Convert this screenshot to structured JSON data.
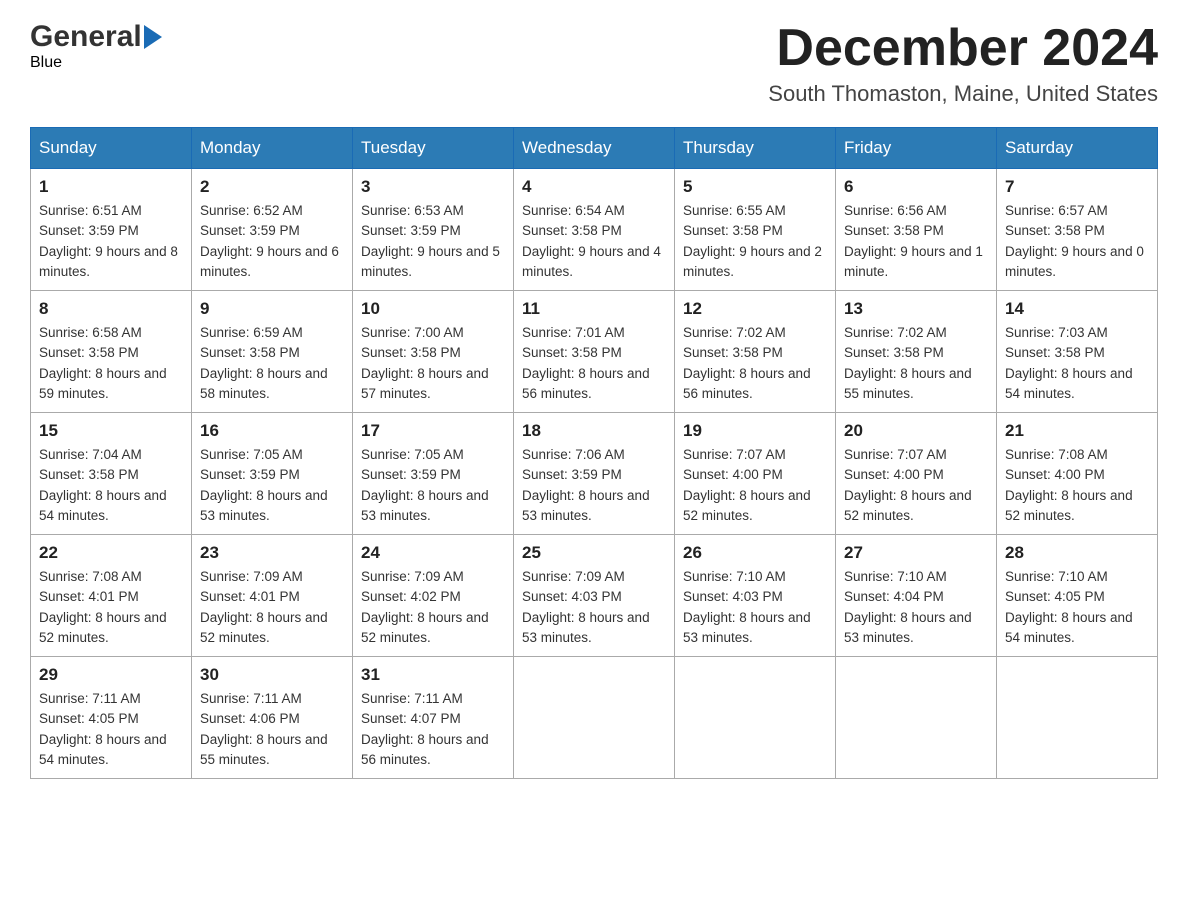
{
  "header": {
    "logo_general": "General",
    "logo_blue": "Blue",
    "month_title": "December 2024",
    "location": "South Thomaston, Maine, United States"
  },
  "days_of_week": [
    "Sunday",
    "Monday",
    "Tuesday",
    "Wednesday",
    "Thursday",
    "Friday",
    "Saturday"
  ],
  "weeks": [
    [
      {
        "day": "1",
        "sunrise": "6:51 AM",
        "sunset": "3:59 PM",
        "daylight": "9 hours and 8 minutes."
      },
      {
        "day": "2",
        "sunrise": "6:52 AM",
        "sunset": "3:59 PM",
        "daylight": "9 hours and 6 minutes."
      },
      {
        "day": "3",
        "sunrise": "6:53 AM",
        "sunset": "3:59 PM",
        "daylight": "9 hours and 5 minutes."
      },
      {
        "day": "4",
        "sunrise": "6:54 AM",
        "sunset": "3:58 PM",
        "daylight": "9 hours and 4 minutes."
      },
      {
        "day": "5",
        "sunrise": "6:55 AM",
        "sunset": "3:58 PM",
        "daylight": "9 hours and 2 minutes."
      },
      {
        "day": "6",
        "sunrise": "6:56 AM",
        "sunset": "3:58 PM",
        "daylight": "9 hours and 1 minute."
      },
      {
        "day": "7",
        "sunrise": "6:57 AM",
        "sunset": "3:58 PM",
        "daylight": "9 hours and 0 minutes."
      }
    ],
    [
      {
        "day": "8",
        "sunrise": "6:58 AM",
        "sunset": "3:58 PM",
        "daylight": "8 hours and 59 minutes."
      },
      {
        "day": "9",
        "sunrise": "6:59 AM",
        "sunset": "3:58 PM",
        "daylight": "8 hours and 58 minutes."
      },
      {
        "day": "10",
        "sunrise": "7:00 AM",
        "sunset": "3:58 PM",
        "daylight": "8 hours and 57 minutes."
      },
      {
        "day": "11",
        "sunrise": "7:01 AM",
        "sunset": "3:58 PM",
        "daylight": "8 hours and 56 minutes."
      },
      {
        "day": "12",
        "sunrise": "7:02 AM",
        "sunset": "3:58 PM",
        "daylight": "8 hours and 56 minutes."
      },
      {
        "day": "13",
        "sunrise": "7:02 AM",
        "sunset": "3:58 PM",
        "daylight": "8 hours and 55 minutes."
      },
      {
        "day": "14",
        "sunrise": "7:03 AM",
        "sunset": "3:58 PM",
        "daylight": "8 hours and 54 minutes."
      }
    ],
    [
      {
        "day": "15",
        "sunrise": "7:04 AM",
        "sunset": "3:58 PM",
        "daylight": "8 hours and 54 minutes."
      },
      {
        "day": "16",
        "sunrise": "7:05 AM",
        "sunset": "3:59 PM",
        "daylight": "8 hours and 53 minutes."
      },
      {
        "day": "17",
        "sunrise": "7:05 AM",
        "sunset": "3:59 PM",
        "daylight": "8 hours and 53 minutes."
      },
      {
        "day": "18",
        "sunrise": "7:06 AM",
        "sunset": "3:59 PM",
        "daylight": "8 hours and 53 minutes."
      },
      {
        "day": "19",
        "sunrise": "7:07 AM",
        "sunset": "4:00 PM",
        "daylight": "8 hours and 52 minutes."
      },
      {
        "day": "20",
        "sunrise": "7:07 AM",
        "sunset": "4:00 PM",
        "daylight": "8 hours and 52 minutes."
      },
      {
        "day": "21",
        "sunrise": "7:08 AM",
        "sunset": "4:00 PM",
        "daylight": "8 hours and 52 minutes."
      }
    ],
    [
      {
        "day": "22",
        "sunrise": "7:08 AM",
        "sunset": "4:01 PM",
        "daylight": "8 hours and 52 minutes."
      },
      {
        "day": "23",
        "sunrise": "7:09 AM",
        "sunset": "4:01 PM",
        "daylight": "8 hours and 52 minutes."
      },
      {
        "day": "24",
        "sunrise": "7:09 AM",
        "sunset": "4:02 PM",
        "daylight": "8 hours and 52 minutes."
      },
      {
        "day": "25",
        "sunrise": "7:09 AM",
        "sunset": "4:03 PM",
        "daylight": "8 hours and 53 minutes."
      },
      {
        "day": "26",
        "sunrise": "7:10 AM",
        "sunset": "4:03 PM",
        "daylight": "8 hours and 53 minutes."
      },
      {
        "day": "27",
        "sunrise": "7:10 AM",
        "sunset": "4:04 PM",
        "daylight": "8 hours and 53 minutes."
      },
      {
        "day": "28",
        "sunrise": "7:10 AM",
        "sunset": "4:05 PM",
        "daylight": "8 hours and 54 minutes."
      }
    ],
    [
      {
        "day": "29",
        "sunrise": "7:11 AM",
        "sunset": "4:05 PM",
        "daylight": "8 hours and 54 minutes."
      },
      {
        "day": "30",
        "sunrise": "7:11 AM",
        "sunset": "4:06 PM",
        "daylight": "8 hours and 55 minutes."
      },
      {
        "day": "31",
        "sunrise": "7:11 AM",
        "sunset": "4:07 PM",
        "daylight": "8 hours and 56 minutes."
      },
      null,
      null,
      null,
      null
    ]
  ],
  "labels": {
    "sunrise": "Sunrise:",
    "sunset": "Sunset:",
    "daylight": "Daylight:"
  }
}
